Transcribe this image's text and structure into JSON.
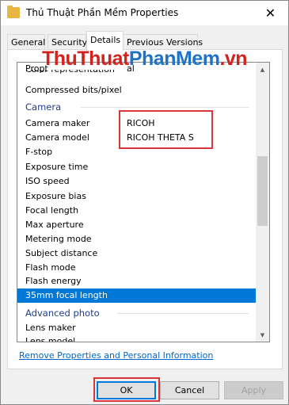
{
  "window": {
    "title": "Thủ Thuật Phần Mềm Properties"
  },
  "tabs": [
    {
      "label": "General"
    },
    {
      "label": "Security"
    },
    {
      "label": "Details"
    },
    {
      "label": "Previous Versions"
    }
  ],
  "watermark": {
    "part1": "ThuThuat",
    "part2": "PhanMem",
    "part3": ".vn"
  },
  "list": {
    "rows": [
      {
        "name": "Propt",
        "value": "al"
      },
      {
        "name": "Color representation",
        "value": ""
      },
      {
        "name": "Compressed bits/pixel",
        "value": ""
      },
      {
        "name": "Camera",
        "value": ""
      },
      {
        "name": "Camera maker",
        "value": "RICOH"
      },
      {
        "name": "Camera model",
        "value": "RICOH THETA S"
      },
      {
        "name": "F-stop",
        "value": ""
      },
      {
        "name": "Exposure time",
        "value": ""
      },
      {
        "name": "ISO speed",
        "value": ""
      },
      {
        "name": "Exposure bias",
        "value": ""
      },
      {
        "name": "Focal length",
        "value": ""
      },
      {
        "name": "Max aperture",
        "value": ""
      },
      {
        "name": "Metering mode",
        "value": ""
      },
      {
        "name": "Subject distance",
        "value": ""
      },
      {
        "name": "Flash mode",
        "value": ""
      },
      {
        "name": "Flash energy",
        "value": ""
      },
      {
        "name": "35mm focal length",
        "value": ""
      },
      {
        "name": "Advanced photo",
        "value": ""
      },
      {
        "name": "Lens maker",
        "value": ""
      },
      {
        "name": "Lens model",
        "value": ""
      }
    ]
  },
  "remove_link": "Remove Properties and Personal Information",
  "buttons": {
    "ok": "OK",
    "cancel": "Cancel",
    "apply": "Apply"
  }
}
